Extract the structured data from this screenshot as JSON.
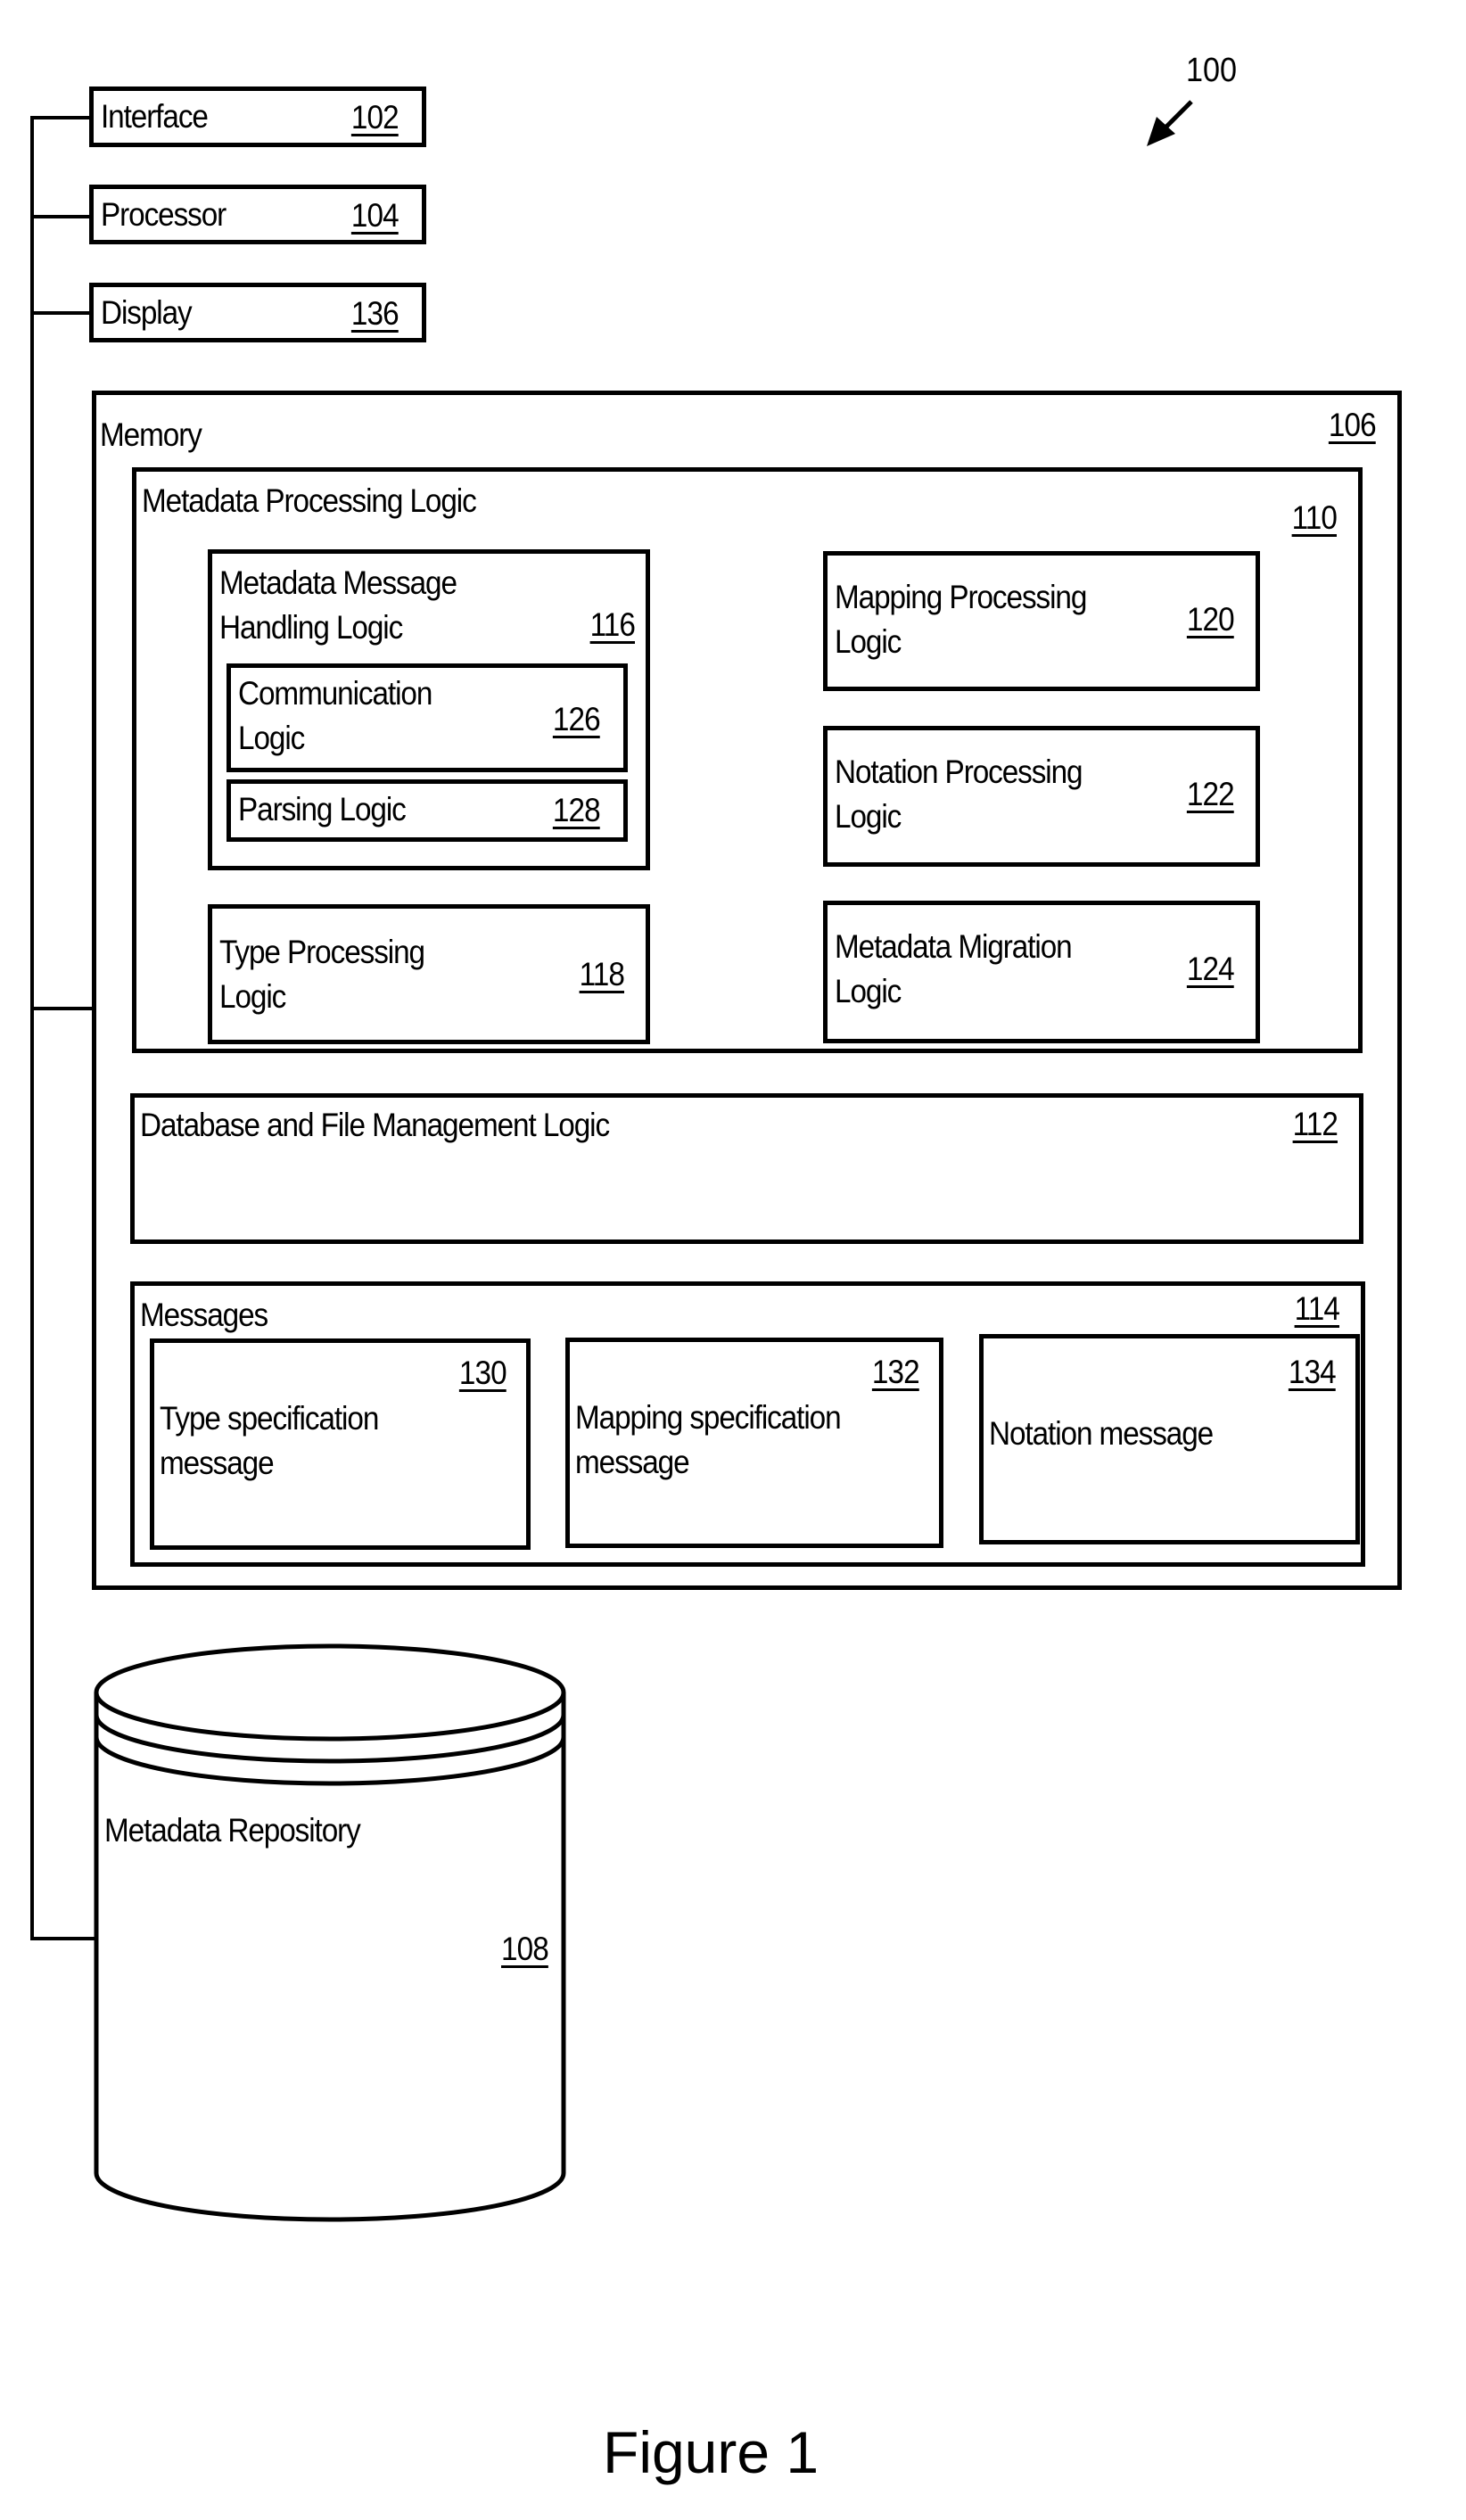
{
  "figure": {
    "caption": "Figure 1",
    "system_ref": "100"
  },
  "components": {
    "interface": {
      "label": "Interface",
      "ref": "102"
    },
    "processor": {
      "label": "Processor",
      "ref": "104"
    },
    "display": {
      "label": "Display",
      "ref": "136"
    },
    "memory": {
      "label": "Memory",
      "ref": "106"
    },
    "repository": {
      "label": "Metadata Repository",
      "ref": "108"
    }
  },
  "memory": {
    "metadata_processing_logic": {
      "label": "Metadata Processing Logic",
      "ref": "110",
      "message_handling": {
        "label": "Metadata Message\nHandling Logic",
        "ref": "116",
        "communication": {
          "label": "Communication\nLogic",
          "ref": "126"
        },
        "parsing": {
          "label": "Parsing Logic",
          "ref": "128"
        }
      },
      "type_processing": {
        "label": "Type Processing\nLogic",
        "ref": "118"
      },
      "mapping_processing": {
        "label": "Mapping Processing\nLogic",
        "ref": "120"
      },
      "notation_processing": {
        "label": "Notation Processing\nLogic",
        "ref": "122"
      },
      "metadata_migration": {
        "label": "Metadata Migration\nLogic",
        "ref": "124"
      }
    },
    "database_file_management": {
      "label": "Database and File Management Logic",
      "ref": "112"
    },
    "messages": {
      "label": "Messages",
      "ref": "114",
      "items": [
        {
          "label": "Type specification\nmessage",
          "ref": "130"
        },
        {
          "label": "Mapping specification\nmessage",
          "ref": "132"
        },
        {
          "label": "Notation message",
          "ref": "134"
        }
      ]
    }
  }
}
